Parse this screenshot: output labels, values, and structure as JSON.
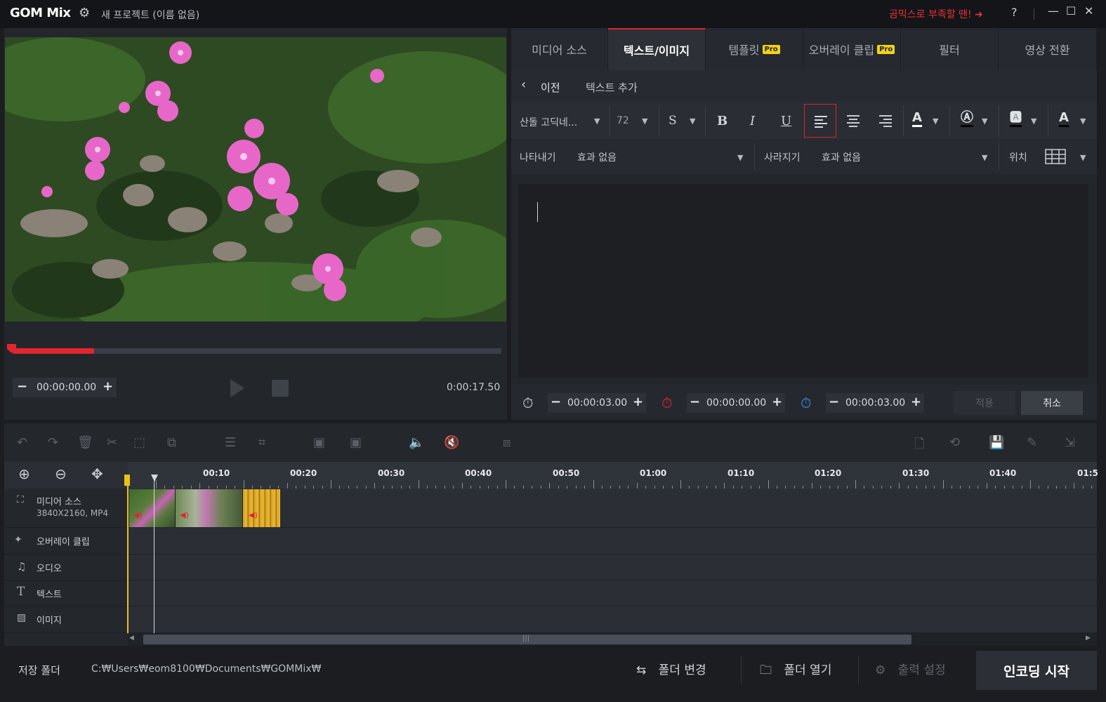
{
  "titlebar": {
    "app_name": "GOM Mix",
    "project_title": "새 프로젝트 (이름 없음)",
    "promo": "곰믹스로 부족할 땐!",
    "help": "?",
    "minimize": "—",
    "maximize": "☐",
    "close": "✕"
  },
  "preview": {
    "current_time": "00:00:00.00",
    "duration": "0:00:17.50",
    "progress_fraction": 0.167
  },
  "tabs": [
    {
      "label": "미디어 소스"
    },
    {
      "label": "텍스트/이미지"
    },
    {
      "label": "템플릿",
      "badge": "Pro"
    },
    {
      "label": "오버레이 클립",
      "badge": "Pro"
    },
    {
      "label": "필터"
    },
    {
      "label": "영상 전환"
    }
  ],
  "subbar": {
    "back_label": "이전",
    "title": "텍스트 추가"
  },
  "format": {
    "font": "산돌 고딕네...",
    "size": "72",
    "strike": "S",
    "bold": "B",
    "italic": "I",
    "underline": "U"
  },
  "effects": {
    "appear_label": "나타내기",
    "appear_value": "효과 없음",
    "disappear_label": "사라지기",
    "disappear_value": "효과 없음",
    "position_label": "위치"
  },
  "timing": {
    "duration": "00:00:03.00",
    "start": "00:00:00.00",
    "end": "00:00:03.00",
    "apply_label": "적용",
    "cancel_label": "취소"
  },
  "timeline": {
    "ticks": [
      "00:10",
      "00:20",
      "00:30",
      "00:40",
      "00:50",
      "01:00",
      "01:10",
      "01:20",
      "01:30",
      "01:40",
      "01:5"
    ],
    "tracks": [
      {
        "name": "미디어 소스",
        "sub": "3840X2160, MP4"
      },
      {
        "name": "오버레이 클립"
      },
      {
        "name": "오디오"
      },
      {
        "name": "텍스트"
      },
      {
        "name": "이미지"
      }
    ]
  },
  "footer": {
    "save_folder_label": "저장 폴더",
    "save_path": "C:₩Users₩eom8100₩Documents₩GOMMix₩",
    "change_folder": "폴더 변경",
    "open_folder": "폴더 열기",
    "output_settings": "출력 설정",
    "encode": "인코딩 시작"
  },
  "colors": {
    "accent": "#e0262f",
    "pro_badge": "#f2d410"
  }
}
